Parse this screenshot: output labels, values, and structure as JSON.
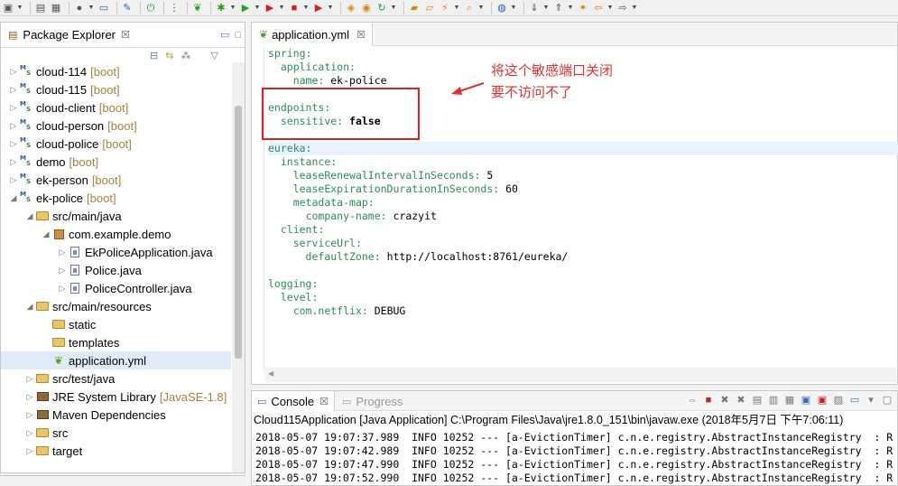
{
  "toolbar": {
    "icons": [
      "new-icon",
      "save-icon",
      "save-all-icon",
      "person-icon",
      "layout-icon",
      "pin-icon",
      "power-icon",
      "column-icon",
      "spring-icon",
      "debug-icon",
      "run-icon",
      "coverage-icon",
      "stop-icon",
      "external-run-icon",
      "package-icon",
      "class-icon",
      "refresh-icon",
      "folder-icon",
      "open-folder-icon",
      "wand-icon",
      "search-icon",
      "globe-icon",
      "annotation-icon",
      "down-arrow-icon",
      "up-arrow-icon",
      "back-icon",
      "forward-icon"
    ]
  },
  "package_explorer": {
    "tab_label": "Package Explorer",
    "tab_close": "☒",
    "items": [
      {
        "label": "cloud-114",
        "suffix": "[boot]",
        "indent": 0,
        "arrow": "▷",
        "icon": "spring-project-icon"
      },
      {
        "label": "cloud-115",
        "suffix": "[boot]",
        "indent": 0,
        "arrow": "▷",
        "icon": "spring-project-icon"
      },
      {
        "label": "cloud-client",
        "suffix": "[boot]",
        "indent": 0,
        "arrow": "▷",
        "icon": "spring-project-icon"
      },
      {
        "label": "cloud-person",
        "suffix": "[boot]",
        "indent": 0,
        "arrow": "▷",
        "icon": "spring-project-icon"
      },
      {
        "label": "cloud-police",
        "suffix": "[boot]",
        "indent": 0,
        "arrow": "▷",
        "icon": "spring-project-icon"
      },
      {
        "label": "demo",
        "suffix": "[boot]",
        "indent": 0,
        "arrow": "▷",
        "icon": "spring-project-icon"
      },
      {
        "label": "ek-person",
        "suffix": "[boot]",
        "indent": 0,
        "arrow": "▷",
        "icon": "spring-project-icon"
      },
      {
        "label": "ek-police",
        "suffix": "[boot]",
        "indent": 0,
        "arrow": "◢",
        "icon": "spring-project-icon"
      },
      {
        "label": "src/main/java",
        "suffix": "",
        "indent": 1,
        "arrow": "◢",
        "icon": "source-folder-icon"
      },
      {
        "label": "com.example.demo",
        "suffix": "",
        "indent": 2,
        "arrow": "◢",
        "icon": "package-icon"
      },
      {
        "label": "EkPoliceApplication.java",
        "suffix": "",
        "indent": 3,
        "arrow": "▷",
        "icon": "java-file-icon"
      },
      {
        "label": "Police.java",
        "suffix": "",
        "indent": 3,
        "arrow": "▷",
        "icon": "java-file-icon"
      },
      {
        "label": "PoliceController.java",
        "suffix": "",
        "indent": 3,
        "arrow": "▷",
        "icon": "java-file-icon"
      },
      {
        "label": "src/main/resources",
        "suffix": "",
        "indent": 1,
        "arrow": "◢",
        "icon": "source-folder-icon"
      },
      {
        "label": "static",
        "suffix": "",
        "indent": 2,
        "arrow": "",
        "icon": "folder-icon"
      },
      {
        "label": "templates",
        "suffix": "",
        "indent": 2,
        "arrow": "",
        "icon": "folder-icon"
      },
      {
        "label": "application.yml",
        "suffix": "",
        "indent": 2,
        "arrow": "",
        "icon": "yml-file-icon",
        "selected": true
      },
      {
        "label": "src/test/java",
        "suffix": "",
        "indent": 1,
        "arrow": "▷",
        "icon": "source-folder-icon"
      },
      {
        "label": "JRE System Library",
        "suffix": "[JavaSE-1.8]",
        "indent": 1,
        "arrow": "▷",
        "icon": "library-icon"
      },
      {
        "label": "Maven Dependencies",
        "suffix": "",
        "indent": 1,
        "arrow": "▷",
        "icon": "library-icon"
      },
      {
        "label": "src",
        "suffix": "",
        "indent": 1,
        "arrow": "▷",
        "icon": "folder-icon"
      },
      {
        "label": "target",
        "suffix": "",
        "indent": 1,
        "arrow": "▷",
        "icon": "folder-icon"
      }
    ]
  },
  "editor": {
    "tab_label": "application.yml",
    "tab_close": "☒",
    "lines": [
      {
        "indent": "",
        "key": "spring:",
        "value": "",
        "bold": false
      },
      {
        "indent": "  ",
        "key": "application:",
        "value": "",
        "bold": false
      },
      {
        "indent": "    ",
        "key": "name:",
        "value": " ek-police",
        "bold": false
      },
      {
        "indent": "",
        "key": "",
        "value": "",
        "bold": false
      },
      {
        "indent": "",
        "key": "endpoints:",
        "value": "",
        "bold": false
      },
      {
        "indent": "  ",
        "key": "sensitive:",
        "value": " false",
        "bold": true
      },
      {
        "indent": "",
        "key": "",
        "value": "",
        "bold": false
      },
      {
        "indent": "",
        "key": "eureka:",
        "value": "",
        "bold": false,
        "highlight": true
      },
      {
        "indent": "  ",
        "key": "instance:",
        "value": "",
        "bold": false
      },
      {
        "indent": "    ",
        "key": "leaseRenewalIntervalInSeconds:",
        "value": " 5",
        "bold": false
      },
      {
        "indent": "    ",
        "key": "leaseExpirationDurationInSeconds:",
        "value": " 60",
        "bold": false
      },
      {
        "indent": "    ",
        "key": "metadata-map:",
        "value": "",
        "bold": false
      },
      {
        "indent": "      ",
        "key": "company-name:",
        "value": " crazyit",
        "bold": false
      },
      {
        "indent": "  ",
        "key": "client:",
        "value": "",
        "bold": false
      },
      {
        "indent": "    ",
        "key": "serviceUrl:",
        "value": "",
        "bold": false
      },
      {
        "indent": "      ",
        "key": "defaultZone:",
        "value": " http://localhost:8761/eureka/",
        "bold": false
      },
      {
        "indent": "",
        "key": "",
        "value": "",
        "bold": false
      },
      {
        "indent": "",
        "key": "logging:",
        "value": "",
        "bold": false
      },
      {
        "indent": "  ",
        "key": "level:",
        "value": "",
        "bold": false
      },
      {
        "indent": "    ",
        "key": "com.netflix:",
        "value": " DEBUG",
        "bold": false
      }
    ]
  },
  "annotation": {
    "line1": "将这个敏感端口关闭",
    "line2": "要不访问不了",
    "color": "#e03030"
  },
  "console": {
    "tab_label": "Console",
    "tab_close": "☒",
    "progress_label": "Progress",
    "title": "Cloud115Application [Java Application] C:\\Program Files\\Java\\jre1.8.0_151\\bin\\javaw.exe (2018年5月7日 下午7:06:11)",
    "lines": [
      "2018-05-07 19:07:37.989  INFO 10252 --- [a-EvictionTimer] c.n.e.registry.AbstractInstanceRegistry  : R",
      "2018-05-07 19:07:42.989  INFO 10252 --- [a-EvictionTimer] c.n.e.registry.AbstractInstanceRegistry  : R",
      "2018-05-07 19:07:47.990  INFO 10252 --- [a-EvictionTimer] c.n.e.registry.AbstractInstanceRegistry  : R",
      "2018-05-07 19:07:52.990  INFO 10252 --- [a-EvictionTimer] c.n.e.registry.AbstractInstanceRegistry  : R"
    ]
  }
}
